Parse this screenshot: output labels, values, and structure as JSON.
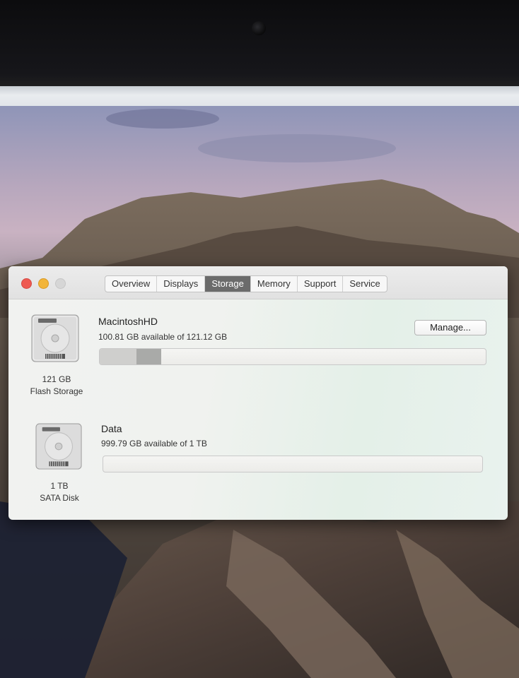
{
  "window": {
    "tabs": [
      {
        "label": "Overview"
      },
      {
        "label": "Displays"
      },
      {
        "label": "Storage",
        "active": true
      },
      {
        "label": "Memory"
      },
      {
        "label": "Support"
      },
      {
        "label": "Service"
      }
    ]
  },
  "volumes": [
    {
      "name": "MacintoshHD",
      "available": "100.81 GB available of 121.12 GB",
      "capacity_label": "121 GB",
      "type_label": "Flash Storage",
      "manage_label": "Manage...",
      "usage_segments": [
        {
          "fraction": 0.095,
          "color": "#cfcfcd"
        },
        {
          "fraction": 0.064,
          "color": "#a9aaa8"
        }
      ]
    },
    {
      "name": "Data",
      "available": "999.79 GB available of 1 TB",
      "capacity_label": "1 TB",
      "type_label": "SATA Disk",
      "usage_segments": []
    }
  ],
  "icons": {
    "disk": "hard-disk-icon"
  },
  "colors": {
    "close": "#ee5a52",
    "minimize": "#f2b53a",
    "active_tab": "#6b6b6b"
  }
}
